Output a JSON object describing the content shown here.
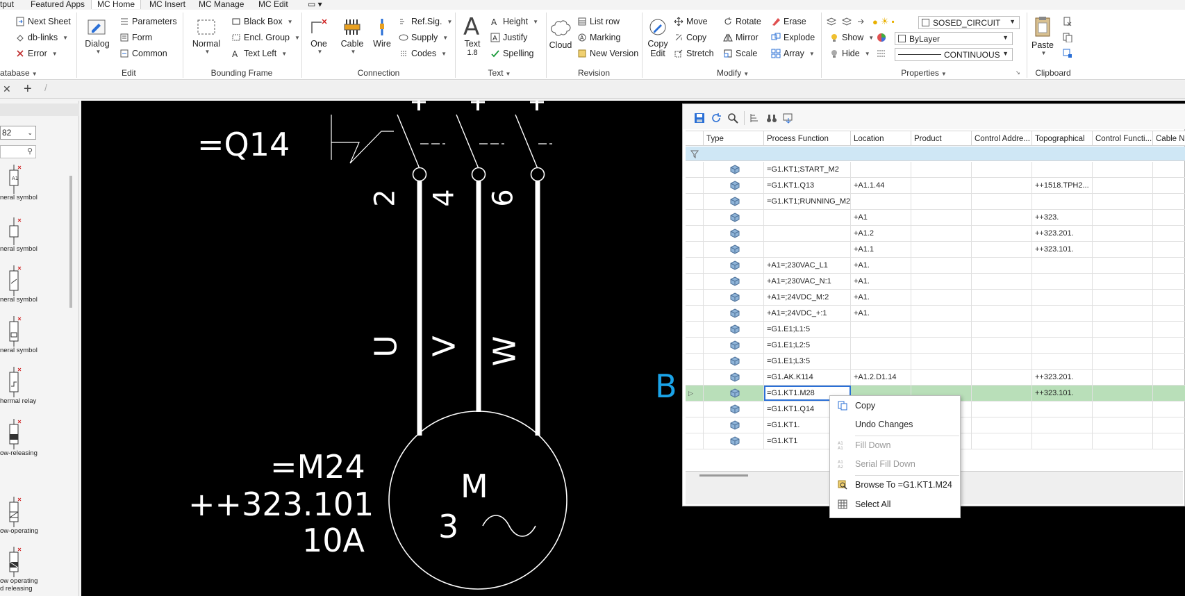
{
  "tabs": [
    "tput",
    "Featured Apps",
    "MC Home",
    "MC Insert",
    "MC Manage",
    "MC Edit",
    "▭ ▾"
  ],
  "ribbon": {
    "sheet": {
      "next": "Next Sheet",
      "db_links": "db-links",
      "error": "Error",
      "group": "atabase"
    },
    "edit": {
      "dialog": "Dialog",
      "parameters": "Parameters",
      "form": "Form",
      "common": "Common",
      "group": "Edit"
    },
    "bounding": {
      "normal": "Normal",
      "black_box": "Black Box",
      "encl_group": "Encl. Group",
      "text_left": "Text Left",
      "group": "Bounding Frame"
    },
    "connection": {
      "one": "One",
      "cable": "Cable",
      "wire": "Wire",
      "ref_sig": "Ref.Sig.",
      "supply": "Supply",
      "codes": "Codes",
      "group": "Connection"
    },
    "text": {
      "text": "Text",
      "text_size": "1.8",
      "height": "Height",
      "justify": "Justify",
      "spelling": "Spelling",
      "group": "Text"
    },
    "revision": {
      "cloud": "Cloud",
      "list_row": "List row",
      "marking": "Marking",
      "new_version": "New Version",
      "group": "Revision"
    },
    "modify": {
      "copy_edit_1": "Copy",
      "copy_edit_2": "Edit",
      "move": "Move",
      "copy": "Copy",
      "stretch": "Stretch",
      "rotate": "Rotate",
      "mirror": "Mirror",
      "scale": "Scale",
      "erase": "Erase",
      "explode": "Explode",
      "array": "Array",
      "group": "Modify"
    },
    "properties": {
      "show": "Show",
      "hide": "Hide",
      "layer": "SOSED_CIRCUIT",
      "color": "ByLayer",
      "linetype": "CONTINUOUS",
      "group": "Properties"
    },
    "clipboard": {
      "paste": "Paste",
      "group": "Clipboard"
    }
  },
  "palette": {
    "combo_value": "82",
    "items": [
      "neral symbol",
      "neral symbol",
      "neral symbol",
      "neral symbol",
      "hermal relay",
      "ow-releasing",
      "ow-operating",
      "ow operating",
      "d releasing"
    ]
  },
  "drawing": {
    "q_label": "=Q14",
    "terminals": [
      "2",
      "4",
      "6"
    ],
    "phases": [
      "U",
      "V",
      "W"
    ],
    "motor_tag": "=M24",
    "motor_loc": "++323.101",
    "motor_current": "10A",
    "motor_letter": "M",
    "motor_phase": "3",
    "cyan_text": "B"
  },
  "grid": {
    "columns": [
      "Type",
      "Process Function",
      "Location",
      "Product",
      "Control Addre...",
      "Topographical",
      "Control Functi...",
      "Cable N"
    ],
    "rows": [
      {
        "pf": "=G1.KT1;START_M2",
        "loc": "",
        "topo": ""
      },
      {
        "pf": "=G1.KT1.Q13",
        "loc": "+A1.1.44",
        "topo": "++1518.TPH2..."
      },
      {
        "pf": "=G1.KT1;RUNNING_M2",
        "loc": "",
        "topo": ""
      },
      {
        "pf": "",
        "loc": "+A1",
        "topo": "++323."
      },
      {
        "pf": "",
        "loc": "+A1.2",
        "topo": "++323.201."
      },
      {
        "pf": "",
        "loc": "+A1.1",
        "topo": "++323.101."
      },
      {
        "pf": "+A1=;230VAC_L1",
        "loc": "+A1.",
        "topo": ""
      },
      {
        "pf": "+A1=;230VAC_N:1",
        "loc": "+A1.",
        "topo": ""
      },
      {
        "pf": "+A1=;24VDC_M:2",
        "loc": "+A1.",
        "topo": ""
      },
      {
        "pf": "+A1=;24VDC_+:1",
        "loc": "+A1.",
        "topo": ""
      },
      {
        "pf": "=G1.E1;L1:5",
        "loc": "",
        "topo": ""
      },
      {
        "pf": "=G1.E1;L2:5",
        "loc": "",
        "topo": ""
      },
      {
        "pf": "=G1.E1;L3:5",
        "loc": "",
        "topo": ""
      },
      {
        "pf": "=G1.AK.K114",
        "loc": "+A1.2.D1.14",
        "topo": "++323.201."
      },
      {
        "pf": "=G1.KT1.M28",
        "loc": "",
        "topo": "++323.101."
      },
      {
        "pf": "=G1.KT1.Q14",
        "loc": "",
        "topo": ""
      },
      {
        "pf": "=G1.KT1.",
        "loc": "",
        "topo": ""
      },
      {
        "pf": "=G1.KT1",
        "loc": "",
        "topo": ""
      }
    ]
  },
  "context_menu": {
    "copy": "Copy",
    "undo": "Undo Changes",
    "fill_down": "Fill Down",
    "serial_fill_down": "Serial Fill Down",
    "browse_to": "Browse To =G1.KT1.M24",
    "select_all": "Select All"
  },
  "colors": {
    "accent": "#2a6fd6",
    "selected_row": "#b9dfb9",
    "filter_row": "#cfe7f5",
    "cad_bg": "#000000",
    "cad_cyan": "#1aa3e8"
  }
}
